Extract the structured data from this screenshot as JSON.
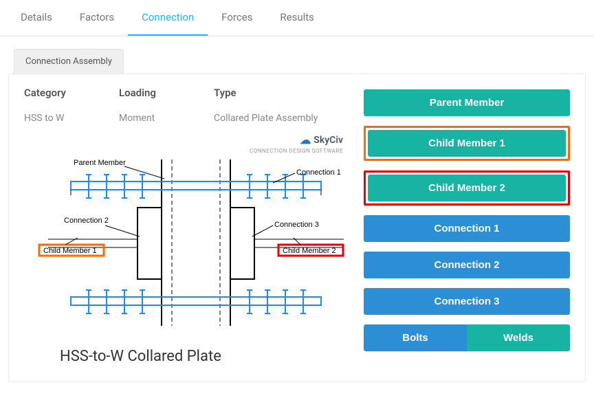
{
  "tabs": {
    "details": "Details",
    "factors": "Factors",
    "connection": "Connection",
    "forces": "Forces",
    "results": "Results"
  },
  "sub_tab": "Connection Assembly",
  "meta": {
    "category_label": "Category",
    "category_value": "HSS to W",
    "loading_label": "Loading",
    "loading_value": "Moment",
    "type_label": "Type",
    "type_value": "Collared Plate Assembly"
  },
  "brand": {
    "name": "SkyCiv",
    "tagline": "CONNECTION DESIGN SOFTWARE"
  },
  "diagram": {
    "parent_member": "Parent Member",
    "connection_1": "Connection 1",
    "connection_2": "Connection 2",
    "connection_3": "Connection 3",
    "child_member_1": "Child Member 1",
    "child_member_2": "Child Member 2",
    "title": "HSS-to-W Collared Plate"
  },
  "side": {
    "parent_member": "Parent Member",
    "child_member_1": "Child Member 1",
    "child_member_2": "Child Member 2",
    "connection_1": "Connection 1",
    "connection_2": "Connection 2",
    "connection_3": "Connection 3",
    "bolts": "Bolts",
    "welds": "Welds"
  }
}
